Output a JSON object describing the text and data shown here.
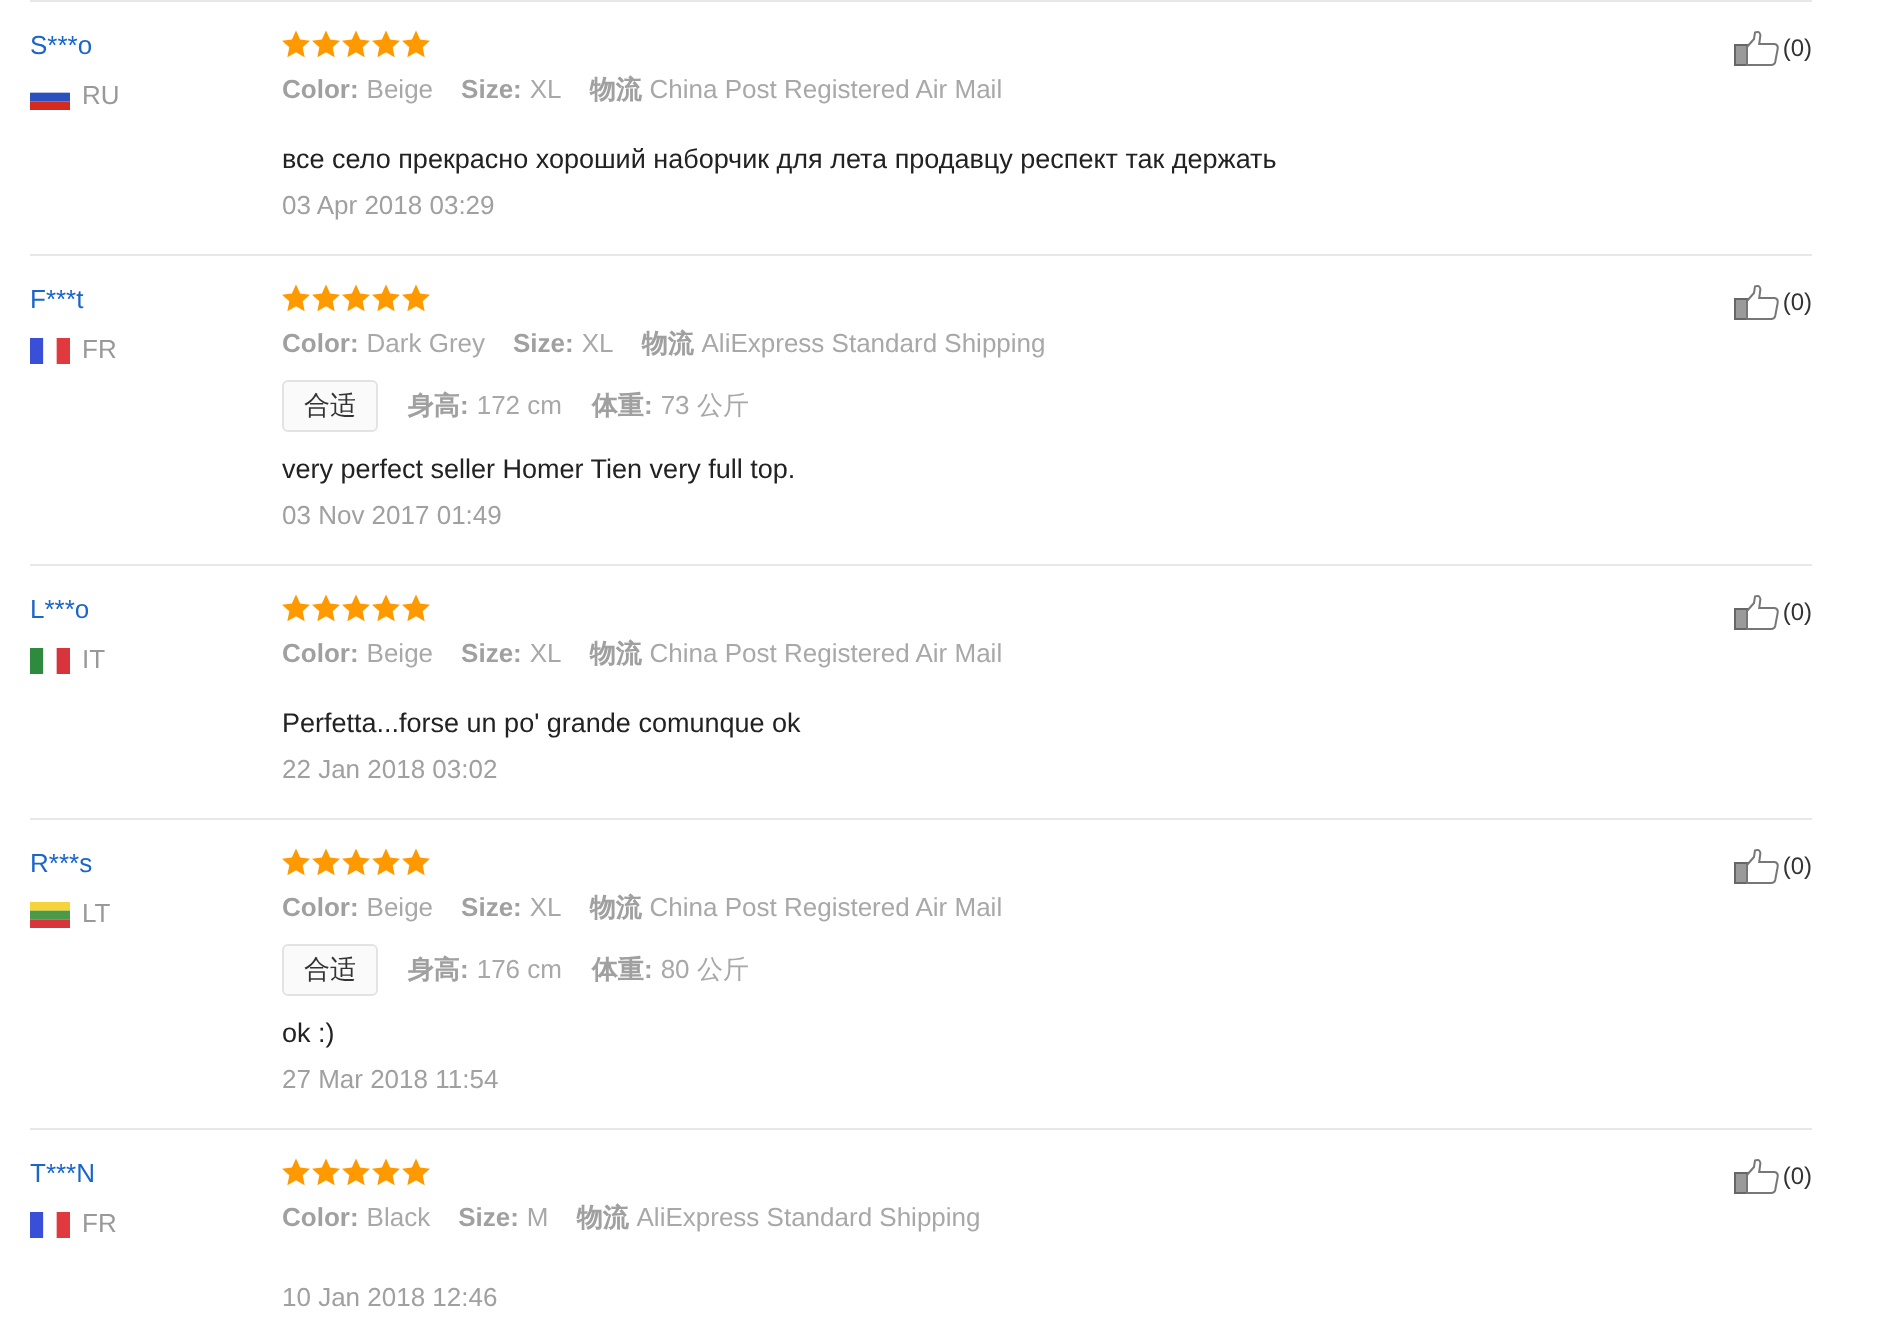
{
  "reviews": [
    {
      "reviewer": "S***o",
      "country": "RU",
      "flag": {
        "kind": "horizontal",
        "stripes": [
          {
            "color": "#ffffff"
          },
          {
            "color": "#2a52be"
          },
          {
            "color": "#d52b1e"
          }
        ]
      },
      "stars": 5,
      "attributes": [
        {
          "label": "Color:",
          "value": "Beige"
        },
        {
          "label": "Size:",
          "value": "XL"
        },
        {
          "label": "物流",
          "value": "China Post Registered Air Mail"
        }
      ],
      "comment": "все село прекрасно хороший наборчик для лета продавцу респект так держать",
      "date": "03 Apr 2018 03:29",
      "likes": "(0)"
    },
    {
      "reviewer": "F***t",
      "country": "FR",
      "flag": {
        "kind": "vertical",
        "stripes": [
          {
            "color": "#3a4fd8"
          },
          {
            "color": "#ffffff"
          },
          {
            "color": "#e03a3e"
          }
        ]
      },
      "stars": 5,
      "attributes": [
        {
          "label": "Color:",
          "value": "Dark Grey"
        },
        {
          "label": "Size:",
          "value": "XL"
        },
        {
          "label": "物流",
          "value": "AliExpress Standard Shipping"
        }
      ],
      "fit": "合适",
      "body": [
        {
          "label": "身高:",
          "value": "172 cm"
        },
        {
          "label": "体重:",
          "value": "73 公斤"
        }
      ],
      "comment": "very perfect seller Homer Tien very full top.",
      "date": "03 Nov 2017 01:49",
      "likes": "(0)"
    },
    {
      "reviewer": "L***o",
      "country": "IT",
      "flag": {
        "kind": "vertical",
        "stripes": [
          {
            "color": "#2e8b3e"
          },
          {
            "color": "#ffffff"
          },
          {
            "color": "#d8343c"
          }
        ]
      },
      "stars": 5,
      "attributes": [
        {
          "label": "Color:",
          "value": "Beige"
        },
        {
          "label": "Size:",
          "value": "XL"
        },
        {
          "label": "物流",
          "value": "China Post Registered Air Mail"
        }
      ],
      "comment": "Perfetta...forse un po' grande comunque ok",
      "date": "22 Jan 2018 03:02",
      "likes": "(0)"
    },
    {
      "reviewer": "R***s",
      "country": "LT",
      "flag": {
        "kind": "horizontal",
        "stripes": [
          {
            "color": "#f5d33a"
          },
          {
            "color": "#4a9a4a"
          },
          {
            "color": "#d8343c"
          }
        ]
      },
      "stars": 5,
      "attributes": [
        {
          "label": "Color:",
          "value": "Beige"
        },
        {
          "label": "Size:",
          "value": "XL"
        },
        {
          "label": "物流",
          "value": "China Post Registered Air Mail"
        }
      ],
      "fit": "合适",
      "body": [
        {
          "label": "身高:",
          "value": "176 cm"
        },
        {
          "label": "体重:",
          "value": "80 公斤"
        }
      ],
      "comment": "ok :)",
      "date": "27 Mar 2018 11:54",
      "likes": "(0)"
    },
    {
      "reviewer": "T***N",
      "country": "FR",
      "flag": {
        "kind": "vertical",
        "stripes": [
          {
            "color": "#3a4fd8"
          },
          {
            "color": "#ffffff"
          },
          {
            "color": "#e03a3e"
          }
        ]
      },
      "stars": 5,
      "attributes": [
        {
          "label": "Color:",
          "value": "Black"
        },
        {
          "label": "Size:",
          "value": "M"
        },
        {
          "label": "物流",
          "value": "AliExpress Standard Shipping"
        }
      ],
      "date": "10 Jan 2018 12:46",
      "likes": "(0)"
    }
  ]
}
